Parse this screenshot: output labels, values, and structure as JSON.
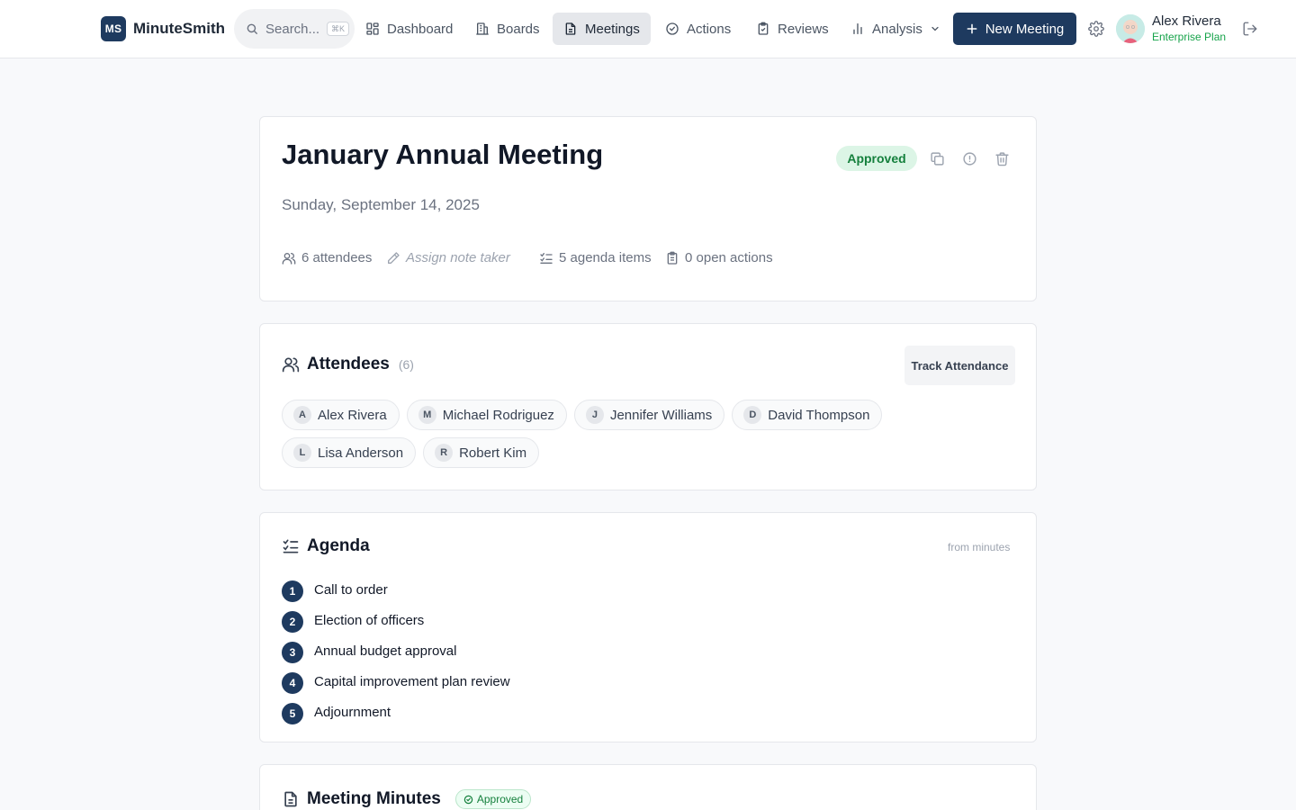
{
  "app": {
    "logo_mark": "MS",
    "name": "MinuteSmith"
  },
  "search": {
    "placeholder": "Search...",
    "shortcut": "⌘K"
  },
  "nav": {
    "items": [
      {
        "label": "Dashboard",
        "icon": "grid-icon"
      },
      {
        "label": "Boards",
        "icon": "building-icon"
      },
      {
        "label": "Meetings",
        "icon": "document-icon",
        "active": true
      },
      {
        "label": "Actions",
        "icon": "check-circle-icon"
      },
      {
        "label": "Reviews",
        "icon": "clipboard-check-icon"
      },
      {
        "label": "Analysis",
        "icon": "bar-chart-icon",
        "dropdown": true
      }
    ],
    "new_button": "New Meeting"
  },
  "user": {
    "name": "Alex Rivera",
    "plan": "Enterprise Plan"
  },
  "meeting": {
    "title": "January Annual Meeting",
    "status": "Approved",
    "date": "Sunday, September 14, 2025",
    "meta": {
      "attendees": "6 attendees",
      "note_taker": "Assign note taker",
      "agenda_items": "5 agenda items",
      "open_actions": "0 open actions"
    }
  },
  "attendees": {
    "title": "Attendees",
    "count": "(6)",
    "track_button": "Track Attendance",
    "people": [
      {
        "initial": "A",
        "name": "Alex Rivera"
      },
      {
        "initial": "M",
        "name": "Michael Rodriguez"
      },
      {
        "initial": "J",
        "name": "Jennifer Williams"
      },
      {
        "initial": "D",
        "name": "David Thompson"
      },
      {
        "initial": "L",
        "name": "Lisa Anderson"
      },
      {
        "initial": "R",
        "name": "Robert Kim"
      }
    ]
  },
  "agenda": {
    "title": "Agenda",
    "source": "from minutes",
    "items": [
      {
        "num": "1",
        "text": "Call to order"
      },
      {
        "num": "2",
        "text": "Election of officers"
      },
      {
        "num": "3",
        "text": "Annual budget approval"
      },
      {
        "num": "4",
        "text": "Capital improvement plan review"
      },
      {
        "num": "5",
        "text": "Adjournment"
      }
    ]
  },
  "minutes": {
    "title": "Meeting Minutes",
    "status": "Approved"
  },
  "colors": {
    "primary": "#1e3a5f",
    "success": "#15803d",
    "success_bg": "#dcf5e6"
  }
}
